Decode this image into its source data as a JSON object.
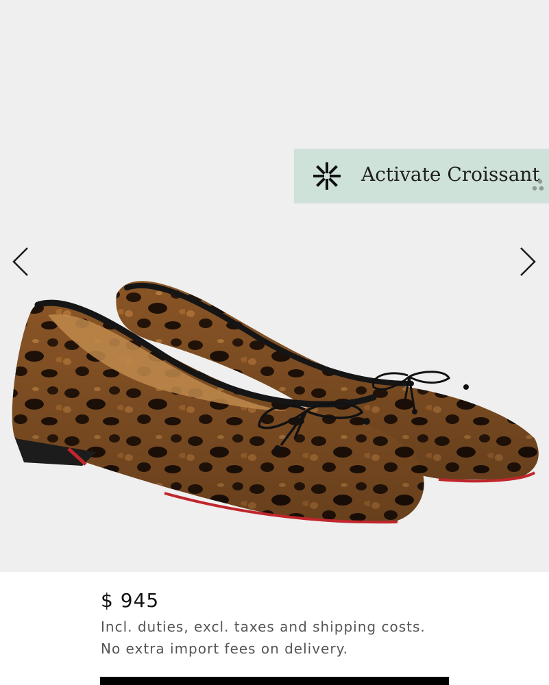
{
  "product": {
    "image_name": "leopard-print-ballet-flats",
    "price": "$ 945",
    "duties_note": "Incl. duties, excl. taxes and shipping costs.",
    "import_note": "No extra import fees on delivery."
  },
  "gallery": {
    "prev_icon": "chevron-left-icon",
    "next_icon": "chevron-right-icon"
  },
  "croissant": {
    "label": "Activate Croissant",
    "icon": "asterisk-star-icon",
    "grip_icon": "dots-grip-icon",
    "background": "#cfe2da"
  },
  "colors": {
    "gallery_bg": "#efefef",
    "sole_red": "#c0262b",
    "cta": "#000000"
  }
}
